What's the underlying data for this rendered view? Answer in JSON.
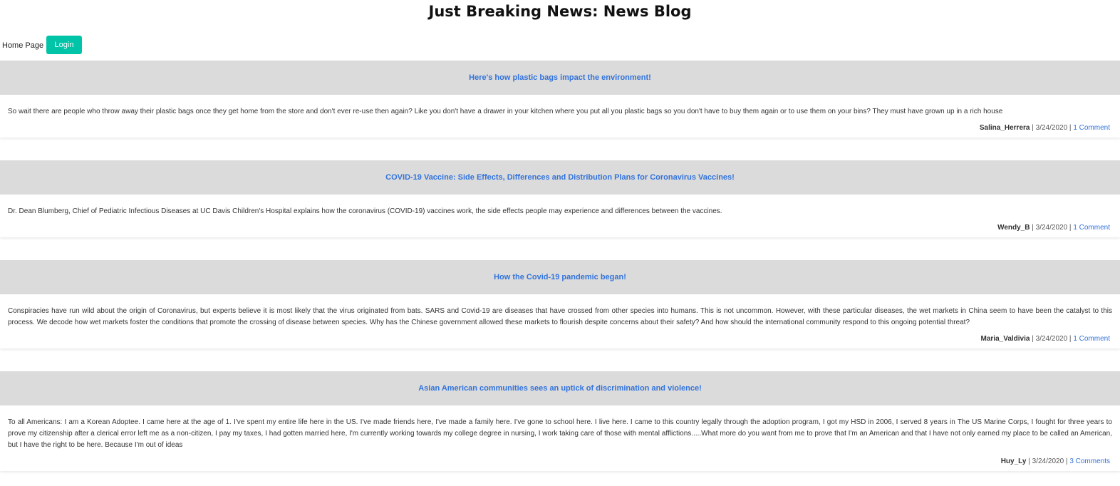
{
  "site": {
    "title": "Just Breaking News: News Blog"
  },
  "nav": {
    "home_label": "Home Page",
    "login_label": "Login"
  },
  "colors": {
    "accent": "#00c4a7",
    "link": "#3273dc",
    "header_bg": "#dbdbdb"
  },
  "posts": [
    {
      "title": "Here's how plastic bags impact the environment!",
      "body": "So wait there are people who throw away their plastic bags once they get home from the store and don't ever re-use then again? Like you don't have a drawer in your kitchen where you put all you plastic bags so you don't have to buy them again or to use them on your bins? They must have grown up in a rich house",
      "author": "Salina_Herrera",
      "date": "3/24/2020",
      "comments": "1 Comment"
    },
    {
      "title": "COVID-19 Vaccine: Side Effects, Differences and Distribution Plans for Coronavirus Vaccines!",
      "body": "Dr. Dean Blumberg, Chief of Pediatric Infectious Diseases at UC Davis Children's Hospital explains how the coronavirus (COVID-19) vaccines work, the side effects people may experience and differences between the vaccines.",
      "author": "Wendy_B",
      "date": "3/24/2020",
      "comments": "1 Comment"
    },
    {
      "title": "How the Covid-19 pandemic began!",
      "body": "Conspiracies have run wild about the origin of Coronavirus, but experts believe it is most likely that the virus originated from bats. SARS and Covid-19 are diseases that have crossed from other species into humans. This is not uncommon. However, with these particular diseases, the wet markets in China seem to have been the catalyst to this process. We decode how wet markets foster the conditions that promote the crossing of disease between species. Why has the Chinese government allowed these markets to flourish despite concerns about their safety? And how should the international community respond to this ongoing potential threat?",
      "author": "Maria_Valdivia",
      "date": "3/24/2020",
      "comments": "1 Comment"
    },
    {
      "title": "Asian American communities sees an uptick of discrimination and violence!",
      "body": "To all Americans: I am a Korean Adoptee. I came here at the age of 1. I've spent my entire life here in the US. I've made friends here, I've made a family here. I've gone to school here. I live here. I came to this country legally through the adoption program, I got my HSD in 2006, I served 8 years in The US Marine Corps, I fought for three years to prove my citizenship after a clerical error left me as a non-citizen, I pay my taxes, I had gotten married here, I'm currently working towards my college degree in nursing, I work taking care of those with mental afflictions.....What more do you want from me to prove that I'm an American and that I have not only earned my place to be called an American, but I have the right to be here. Because I'm out of ideas",
      "author": "Huy_Ly",
      "date": "3/24/2020",
      "comments": "3 Comments"
    }
  ]
}
